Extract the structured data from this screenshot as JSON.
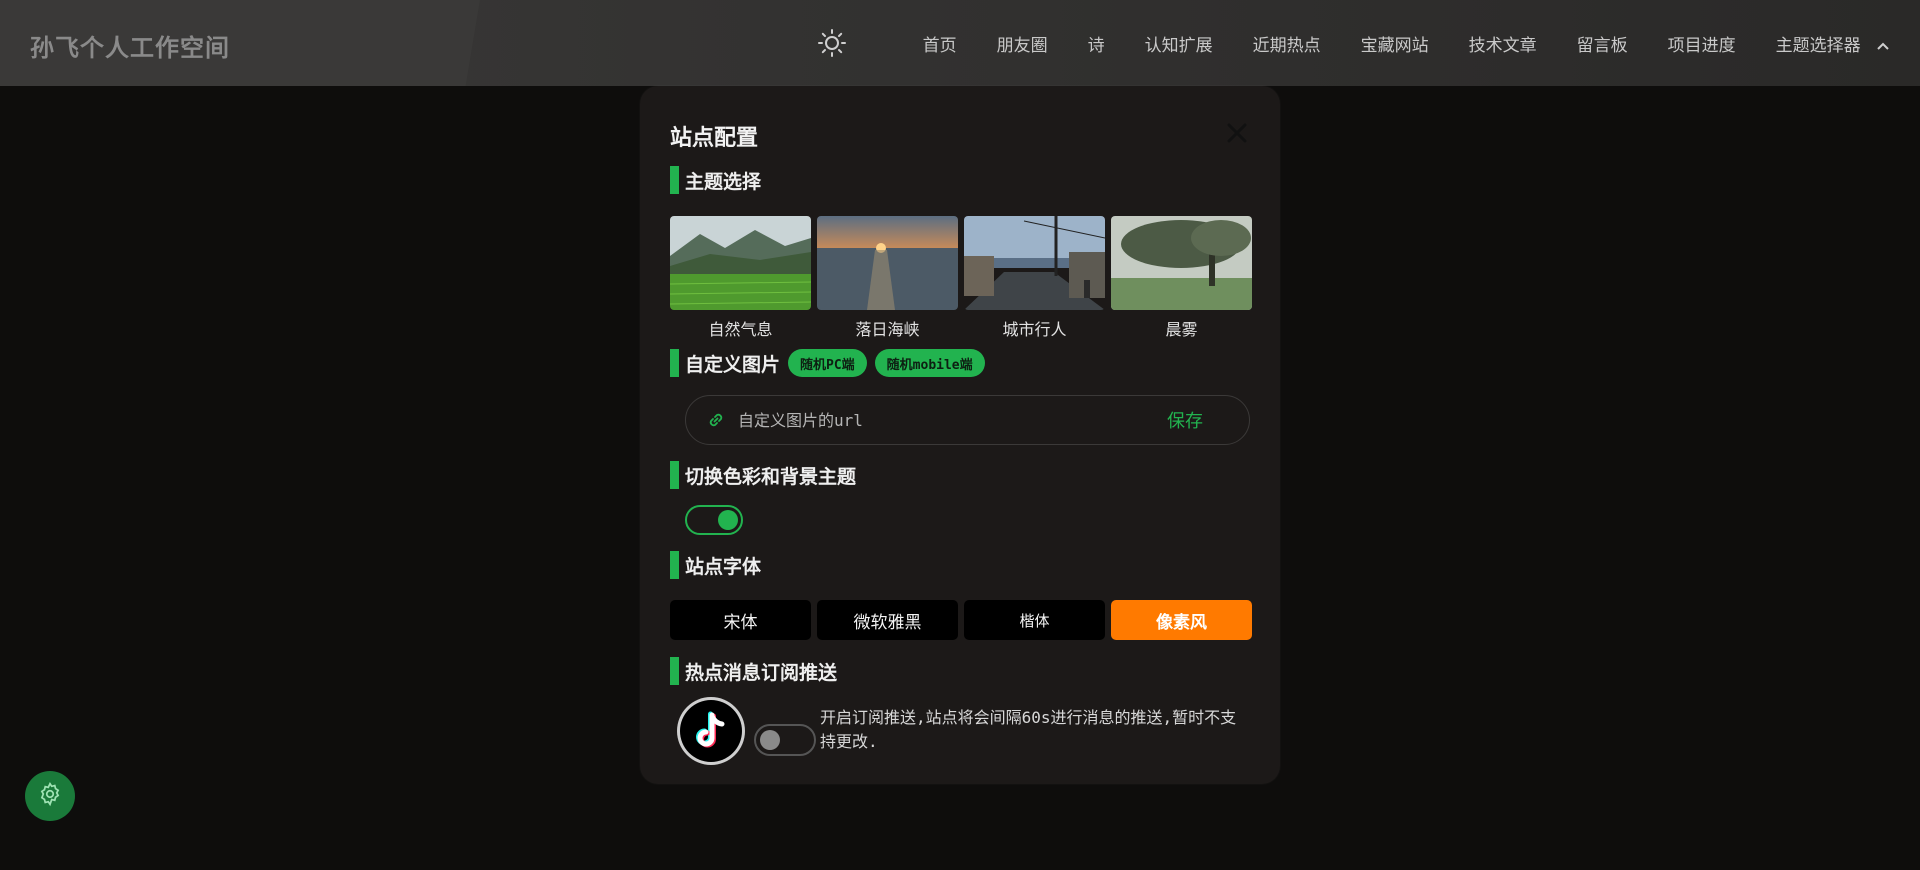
{
  "header": {
    "brand": "孙飞个人工作空间",
    "theme_icon": "sun-icon",
    "nav": [
      {
        "label": "首页"
      },
      {
        "label": "朋友圈"
      },
      {
        "label": "诗"
      },
      {
        "label": "认知扩展"
      },
      {
        "label": "近期热点"
      },
      {
        "label": "宝藏网站"
      },
      {
        "label": "技术文章"
      },
      {
        "label": "留言板"
      },
      {
        "label": "项目进度"
      },
      {
        "label": "主题选择器"
      }
    ]
  },
  "modal": {
    "title": "站点配置",
    "sections": {
      "theme": "主题选择",
      "custom_image": "自定义图片",
      "color_theme": "切换色彩和背景主题",
      "font": "站点字体",
      "push": "热点消息订阅推送"
    },
    "themes": [
      {
        "label": "自然气息"
      },
      {
        "label": "落日海峡"
      },
      {
        "label": "城市行人"
      },
      {
        "label": "晨雾"
      }
    ],
    "chips": [
      "随机PC端",
      "随机mobile端"
    ],
    "url_input": {
      "placeholder": "自定义图片的url",
      "value": ""
    },
    "save_label": "保存",
    "color_toggle_on": true,
    "fonts": [
      {
        "label": "宋体",
        "active": false
      },
      {
        "label": "微软雅黑",
        "active": false
      },
      {
        "label": "楷体",
        "active": false
      },
      {
        "label": "像素风",
        "active": true
      }
    ],
    "push_toggle_on": false,
    "push_description": "开启订阅推送,站点将会间隔60s进行消息的推送,暂时不支持更改."
  },
  "colors": {
    "accent_green": "#22b34f",
    "active_orange": "#ff7a00",
    "background": "#0e0d0c",
    "modal_bg": "#1c1918"
  },
  "fab_icon": "gear-icon"
}
